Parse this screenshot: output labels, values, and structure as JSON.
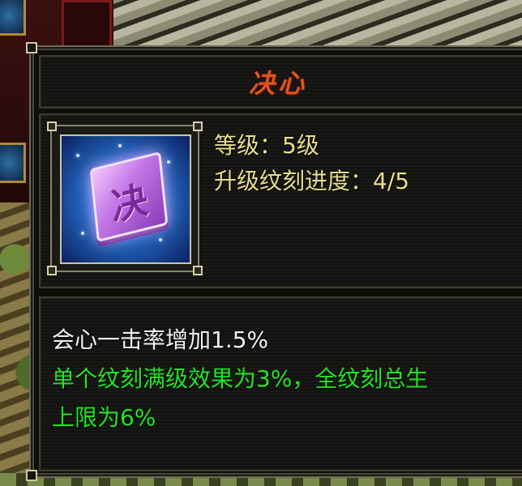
{
  "tooltip": {
    "title": "决心",
    "icon": {
      "name": "engraving-gem-icon",
      "glyph": "决"
    },
    "stats": {
      "level": "等级：5级",
      "upgrade_progress": "升级纹刻进度：4/5"
    },
    "description": {
      "effect": "会心一击率增加1.5%",
      "note_line1": "单个纹刻满级效果为3%，全纹刻总生",
      "note_line2": "上限为6%"
    }
  },
  "colors": {
    "title": "#e0531c",
    "stat_text": "#e9dd8e",
    "effect_text": "#f2f2f2",
    "note_text": "#24e424"
  }
}
